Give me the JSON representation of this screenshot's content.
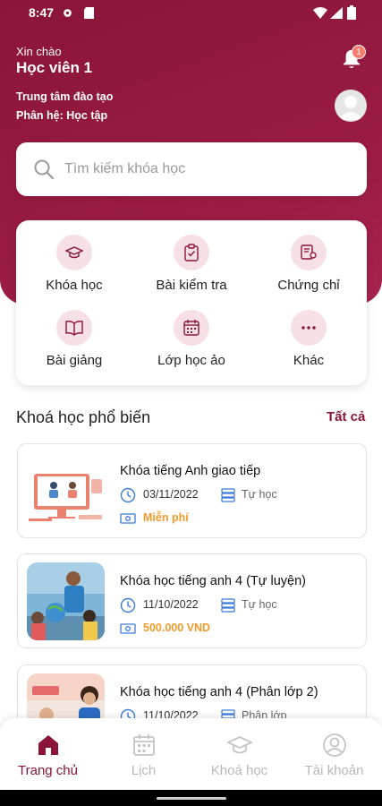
{
  "status_bar": {
    "time": "8:47"
  },
  "header": {
    "greeting": "Xin chào",
    "user_name": "Học viên 1",
    "center": "Trung tâm đào tạo",
    "module": "Phân hệ: Học tập",
    "notification_count": "1"
  },
  "search": {
    "placeholder": "Tìm kiếm khóa học"
  },
  "menu": [
    {
      "label": "Khóa học",
      "icon": "graduation-cap-icon"
    },
    {
      "label": "Bài kiểm tra",
      "icon": "clipboard-check-icon"
    },
    {
      "label": "Chứng chỉ",
      "icon": "certificate-icon"
    },
    {
      "label": "Bài giảng",
      "icon": "book-icon"
    },
    {
      "label": "Lớp học ảo",
      "icon": "calendar-icon"
    },
    {
      "label": "Khác",
      "icon": "more-icon"
    }
  ],
  "popular": {
    "title": "Khoá học phổ biến",
    "see_all": "Tất cả",
    "courses": [
      {
        "title": "Khóa tiếng Anh giao tiếp",
        "date": "03/11/2022",
        "type": "Tự học",
        "price": "Miễn phí"
      },
      {
        "title": "Khóa học tiếng anh 4 (Tự luyện)",
        "date": "11/10/2022",
        "type": "Tự học",
        "price": "500.000 VND"
      },
      {
        "title": "Khóa học tiếng anh 4 (Phân lớp 2)",
        "date": "11/10/2022",
        "type": "Phân lớp",
        "price": ""
      }
    ]
  },
  "bottom_nav": [
    {
      "label": "Trang chủ",
      "icon": "home-icon",
      "active": true
    },
    {
      "label": "Lịch",
      "icon": "calendar-icon"
    },
    {
      "label": "Khoá học",
      "icon": "graduation-cap-icon"
    },
    {
      "label": "Tài khoản",
      "icon": "account-icon"
    }
  ],
  "colors": {
    "primary": "#8a1538",
    "price": "#f39a2b",
    "icon_bg": "#f7dfe6",
    "icon_accent": "#3b7bd8"
  }
}
